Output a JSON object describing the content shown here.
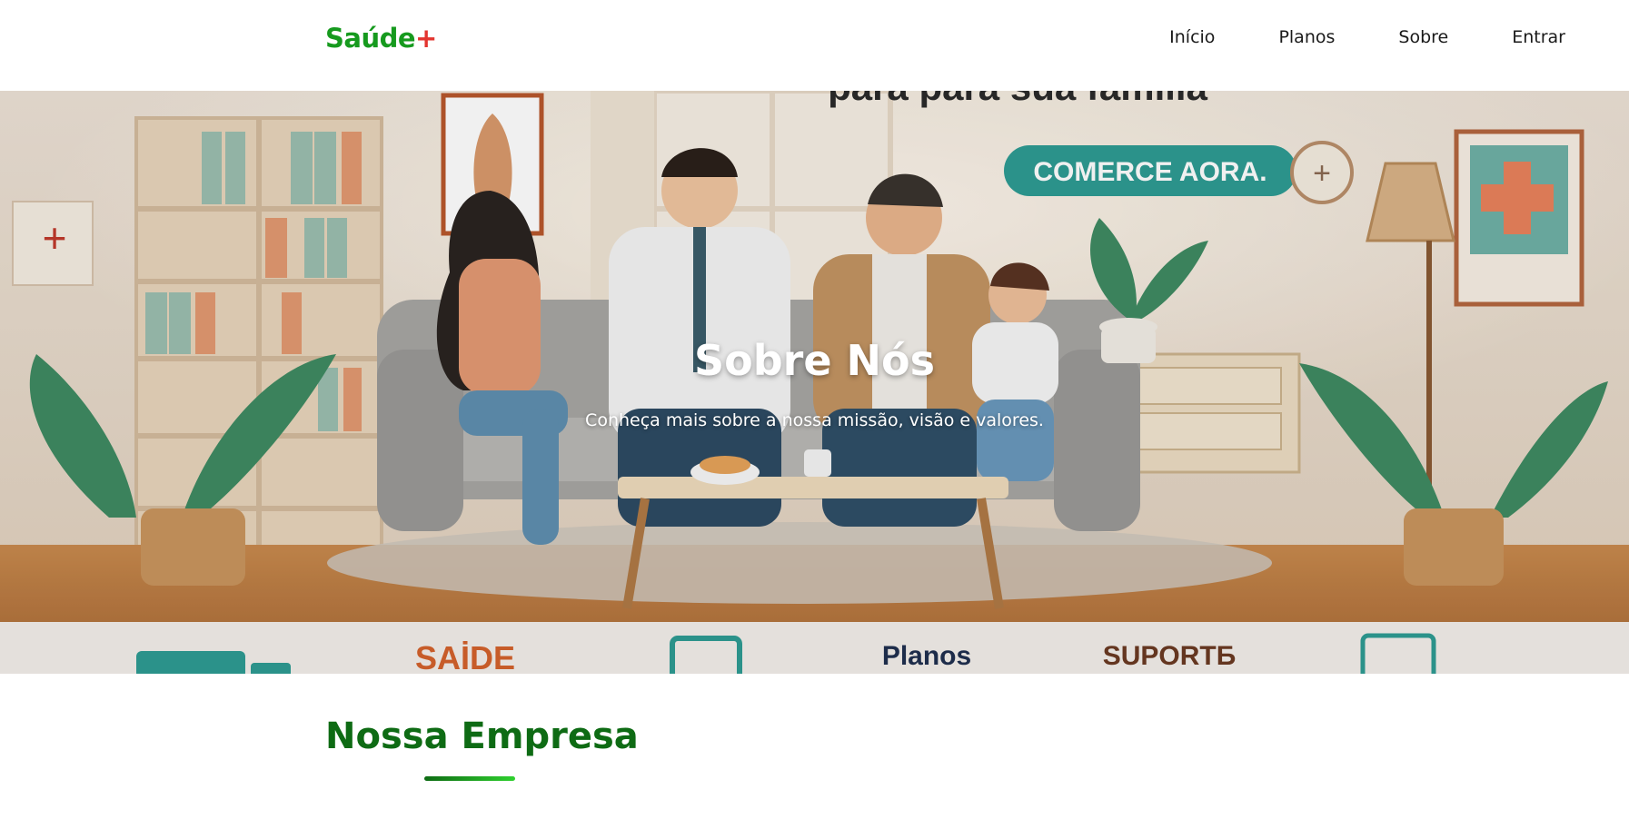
{
  "brand": {
    "name": "Saúde",
    "plus": "+",
    "name_color": "#169a1e",
    "plus_color": "#e3342f"
  },
  "nav": {
    "items": [
      {
        "label": "Início"
      },
      {
        "label": "Planos"
      },
      {
        "label": "Sobre"
      },
      {
        "label": "Entrar"
      }
    ]
  },
  "hero": {
    "title": "Sobre Nós",
    "subtitle": "Conheça mais sobre a nossa missão, visão e valores.",
    "image_text": {
      "cta": "COMERCE AORA.",
      "strip_labels": [
        "SAİDE",
        "Planos",
        "SUPORTБ"
      ]
    }
  },
  "section": {
    "title": "Nossa Empresa",
    "title_color": "#0e6b14",
    "underline_gradient": [
      "#0e6b14",
      "#2fd12f"
    ]
  }
}
